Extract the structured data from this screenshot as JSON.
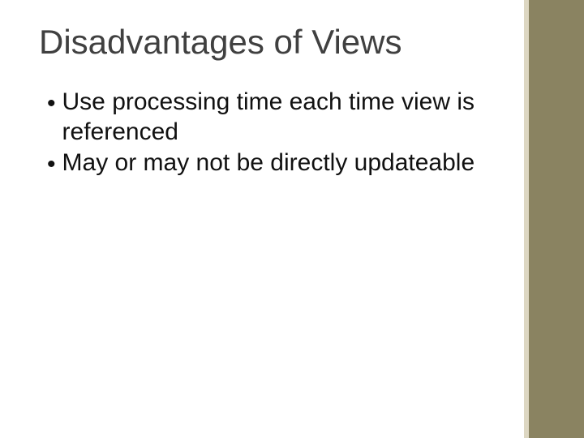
{
  "slide": {
    "title": "Disadvantages of Views",
    "bullets": [
      "Use processing time each time view is referenced",
      "May or may not be directly updateable"
    ]
  }
}
